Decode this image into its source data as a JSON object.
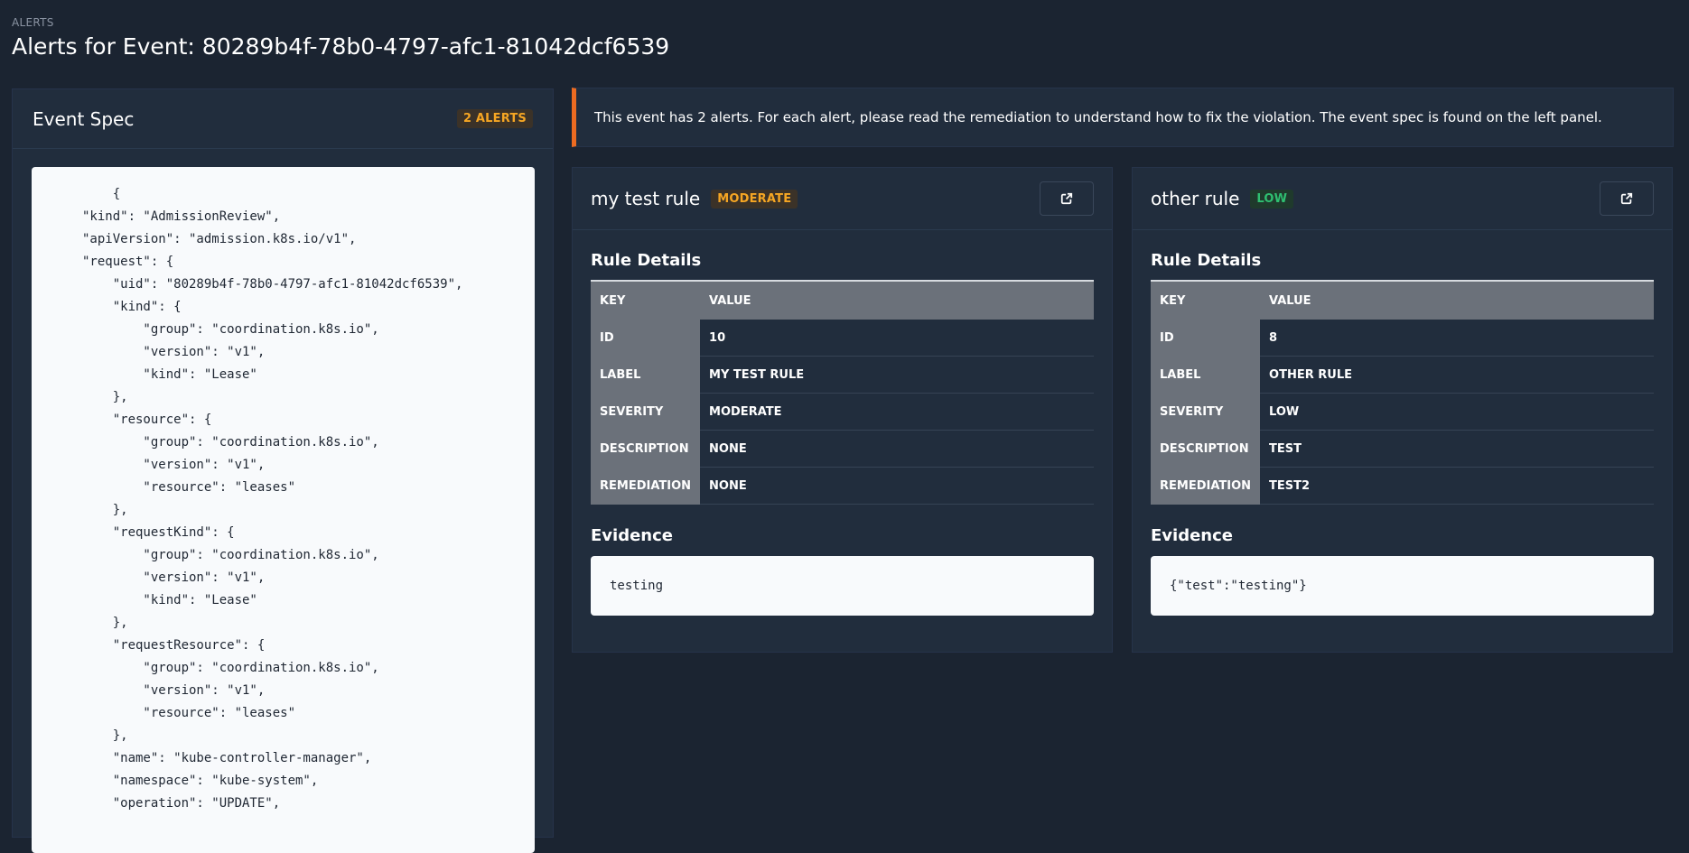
{
  "header": {
    "eyebrow": "ALERTS",
    "title": "Alerts for Event: 80289b4f-78b0-4797-afc1-81042dcf6539"
  },
  "event_spec": {
    "title": "Event Spec",
    "badge": "2 ALERTS",
    "code_lines": [
      "    {",
      "\"kind\": \"AdmissionReview\",",
      "\"apiVersion\": \"admission.k8s.io/v1\",",
      "\"request\": {",
      "    \"uid\": \"80289b4f-78b0-4797-afc1-81042dcf6539\",",
      "    \"kind\": {",
      "        \"group\": \"coordination.k8s.io\",",
      "        \"version\": \"v1\",",
      "        \"kind\": \"Lease\"",
      "    },",
      "    \"resource\": {",
      "        \"group\": \"coordination.k8s.io\",",
      "        \"version\": \"v1\",",
      "        \"resource\": \"leases\"",
      "    },",
      "    \"requestKind\": {",
      "        \"group\": \"coordination.k8s.io\",",
      "        \"version\": \"v1\",",
      "        \"kind\": \"Lease\"",
      "    },",
      "    \"requestResource\": {",
      "        \"group\": \"coordination.k8s.io\",",
      "        \"version\": \"v1\",",
      "        \"resource\": \"leases\"",
      "    },",
      "    \"name\": \"kube-controller-manager\",",
      "    \"namespace\": \"kube-system\",",
      "    \"operation\": \"UPDATE\","
    ]
  },
  "banner": {
    "text": "This event has 2 alerts. For each alert, please read the remediation to understand how to fix the violation. The event spec is found on the left panel."
  },
  "alerts": [
    {
      "title": "my test rule",
      "severity_badge": "MODERATE",
      "rule_details_title": "Rule Details",
      "table_headers": [
        "KEY",
        "VALUE"
      ],
      "rows": [
        {
          "key": "ID",
          "value": "10"
        },
        {
          "key": "LABEL",
          "value": "MY TEST RULE"
        },
        {
          "key": "SEVERITY",
          "value": "MODERATE"
        },
        {
          "key": "DESCRIPTION",
          "value": "NONE"
        },
        {
          "key": "REMEDIATION",
          "value": "NONE"
        }
      ],
      "evidence_title": "Evidence",
      "evidence": "testing"
    },
    {
      "title": "other rule",
      "severity_badge": "LOW",
      "rule_details_title": "Rule Details",
      "table_headers": [
        "KEY",
        "VALUE"
      ],
      "rows": [
        {
          "key": "ID",
          "value": "8"
        },
        {
          "key": "LABEL",
          "value": "OTHER RULE"
        },
        {
          "key": "SEVERITY",
          "value": "LOW"
        },
        {
          "key": "DESCRIPTION",
          "value": "TEST"
        },
        {
          "key": "REMEDIATION",
          "value": "TEST2"
        }
      ],
      "evidence_title": "Evidence",
      "evidence": "{\"test\":\"testing\"}"
    }
  ],
  "colors": {
    "background": "#1b2431",
    "panel": "#212d3d",
    "accent": "#ed6b21",
    "moderate": "#f6a623",
    "low": "#2fbf71"
  },
  "icons": {
    "open_external": "external-link-icon"
  }
}
